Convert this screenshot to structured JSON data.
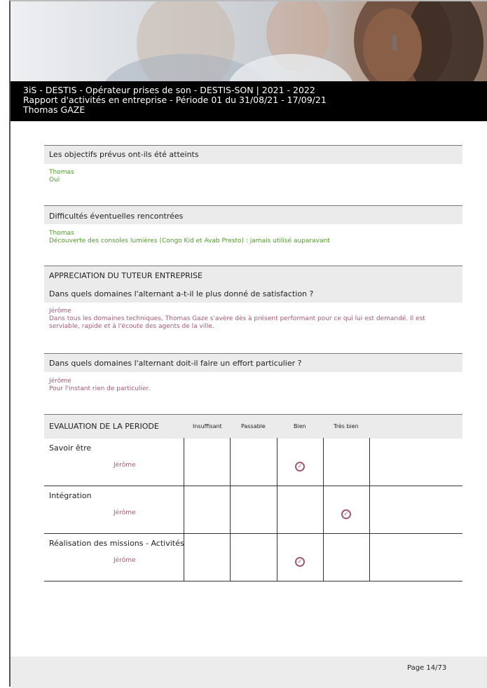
{
  "header": {
    "line1": "3iS - DESTIS - Opérateur prises de son - DESTIS-SON | 2021 - 2022",
    "line2": "Rapport d'activités en entreprise - Période 01 du 31/08/21 - 17/09/21",
    "line3": "Thomas GAZE"
  },
  "sections": {
    "objectifs": {
      "title": "Les objectifs prévus ont-ils été atteints",
      "author": "Thomas",
      "answer": "Oui"
    },
    "difficultes": {
      "title": "Difficultés éventuelles rencontrées",
      "author": "Thomas",
      "answer": "Découverte des consoles lumières (Congo Kid et Avab Presto) : jamais utilisé auparavant"
    },
    "appreciation": {
      "heading": "APPRECIATION DU TUTEUR ENTREPRISE",
      "title": "Dans quels domaines l'alternant a-t-il le plus donné de satisfaction ?",
      "author": "Jérôme",
      "answer_line1": "Dans tous les domaines techniques, Thomas Gaze s'avère dès à présent performant pour ce qui lui est demandé. Il est",
      "answer_line2": "serviable, rapide et à l'écoute des agents de la ville."
    },
    "effort": {
      "title": "Dans quels domaines l'alternant doit-il faire un effort particulier ?",
      "author": "Jérôme",
      "answer": "Pour l'instant rien de particulier."
    }
  },
  "evaluation": {
    "title": "EVALUATION DE LA PERIODE",
    "columns": [
      "Insuffisant",
      "Passable",
      "Bien",
      "Très bien"
    ],
    "rows": [
      {
        "label": "Savoir être",
        "tutor": "Jérôme",
        "rating": "Bien"
      },
      {
        "label": "Intégration",
        "tutor": "Jérôme",
        "rating": "Très bien"
      },
      {
        "label": "Réalisation des missions - Activités",
        "tutor": "Jérôme",
        "rating": "Bien"
      }
    ]
  },
  "footer": {
    "page": "Page 14/73"
  },
  "colors": {
    "tutor_text": "#a25a74",
    "student_text": "#4e9a28",
    "header_bg": "#000000"
  }
}
